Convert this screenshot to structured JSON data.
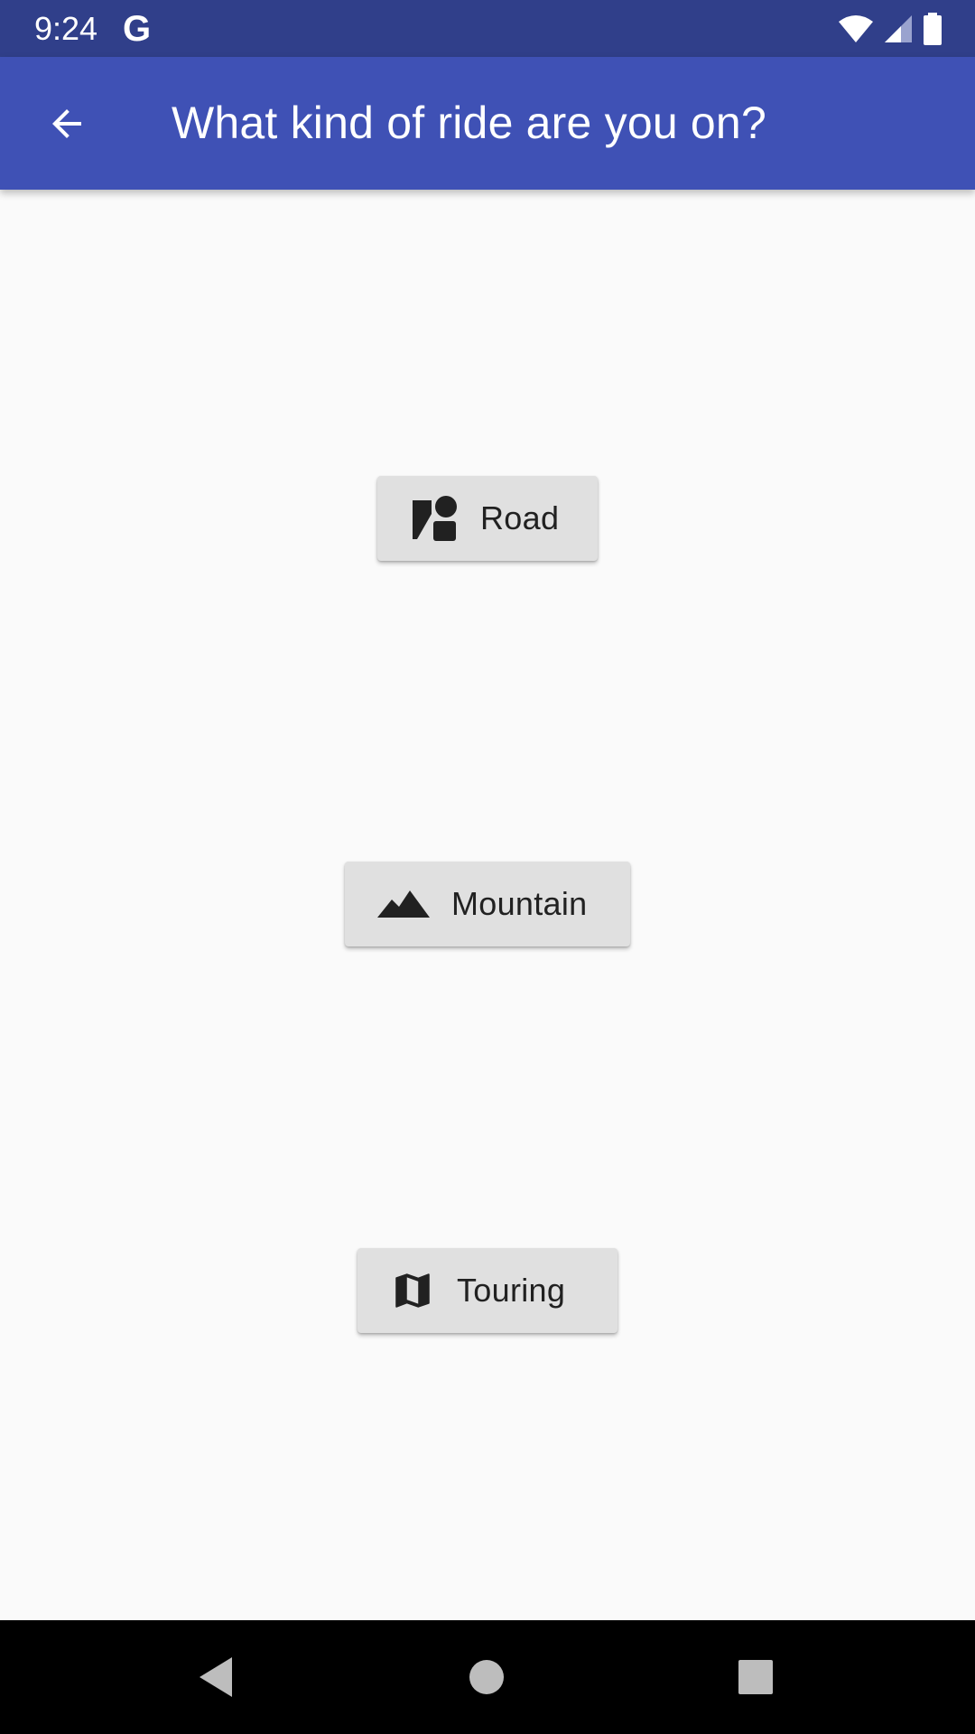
{
  "status_bar": {
    "time": "9:24",
    "google_glyph": "G",
    "icons": [
      "wifi-icon",
      "cellular-signal-icon",
      "battery-icon"
    ]
  },
  "app_bar": {
    "title": "What kind of ride are you on?",
    "back_icon": "arrow-back-icon",
    "background_color": "#3f51b5"
  },
  "ride_options": [
    {
      "label": "Road",
      "icon": "road-icon"
    },
    {
      "label": "Mountain",
      "icon": "mountain-icon"
    },
    {
      "label": "Touring",
      "icon": "map-icon"
    }
  ],
  "nav_bar": {
    "buttons": [
      "back-triangle-icon",
      "home-circle-icon",
      "recents-square-icon"
    ]
  }
}
